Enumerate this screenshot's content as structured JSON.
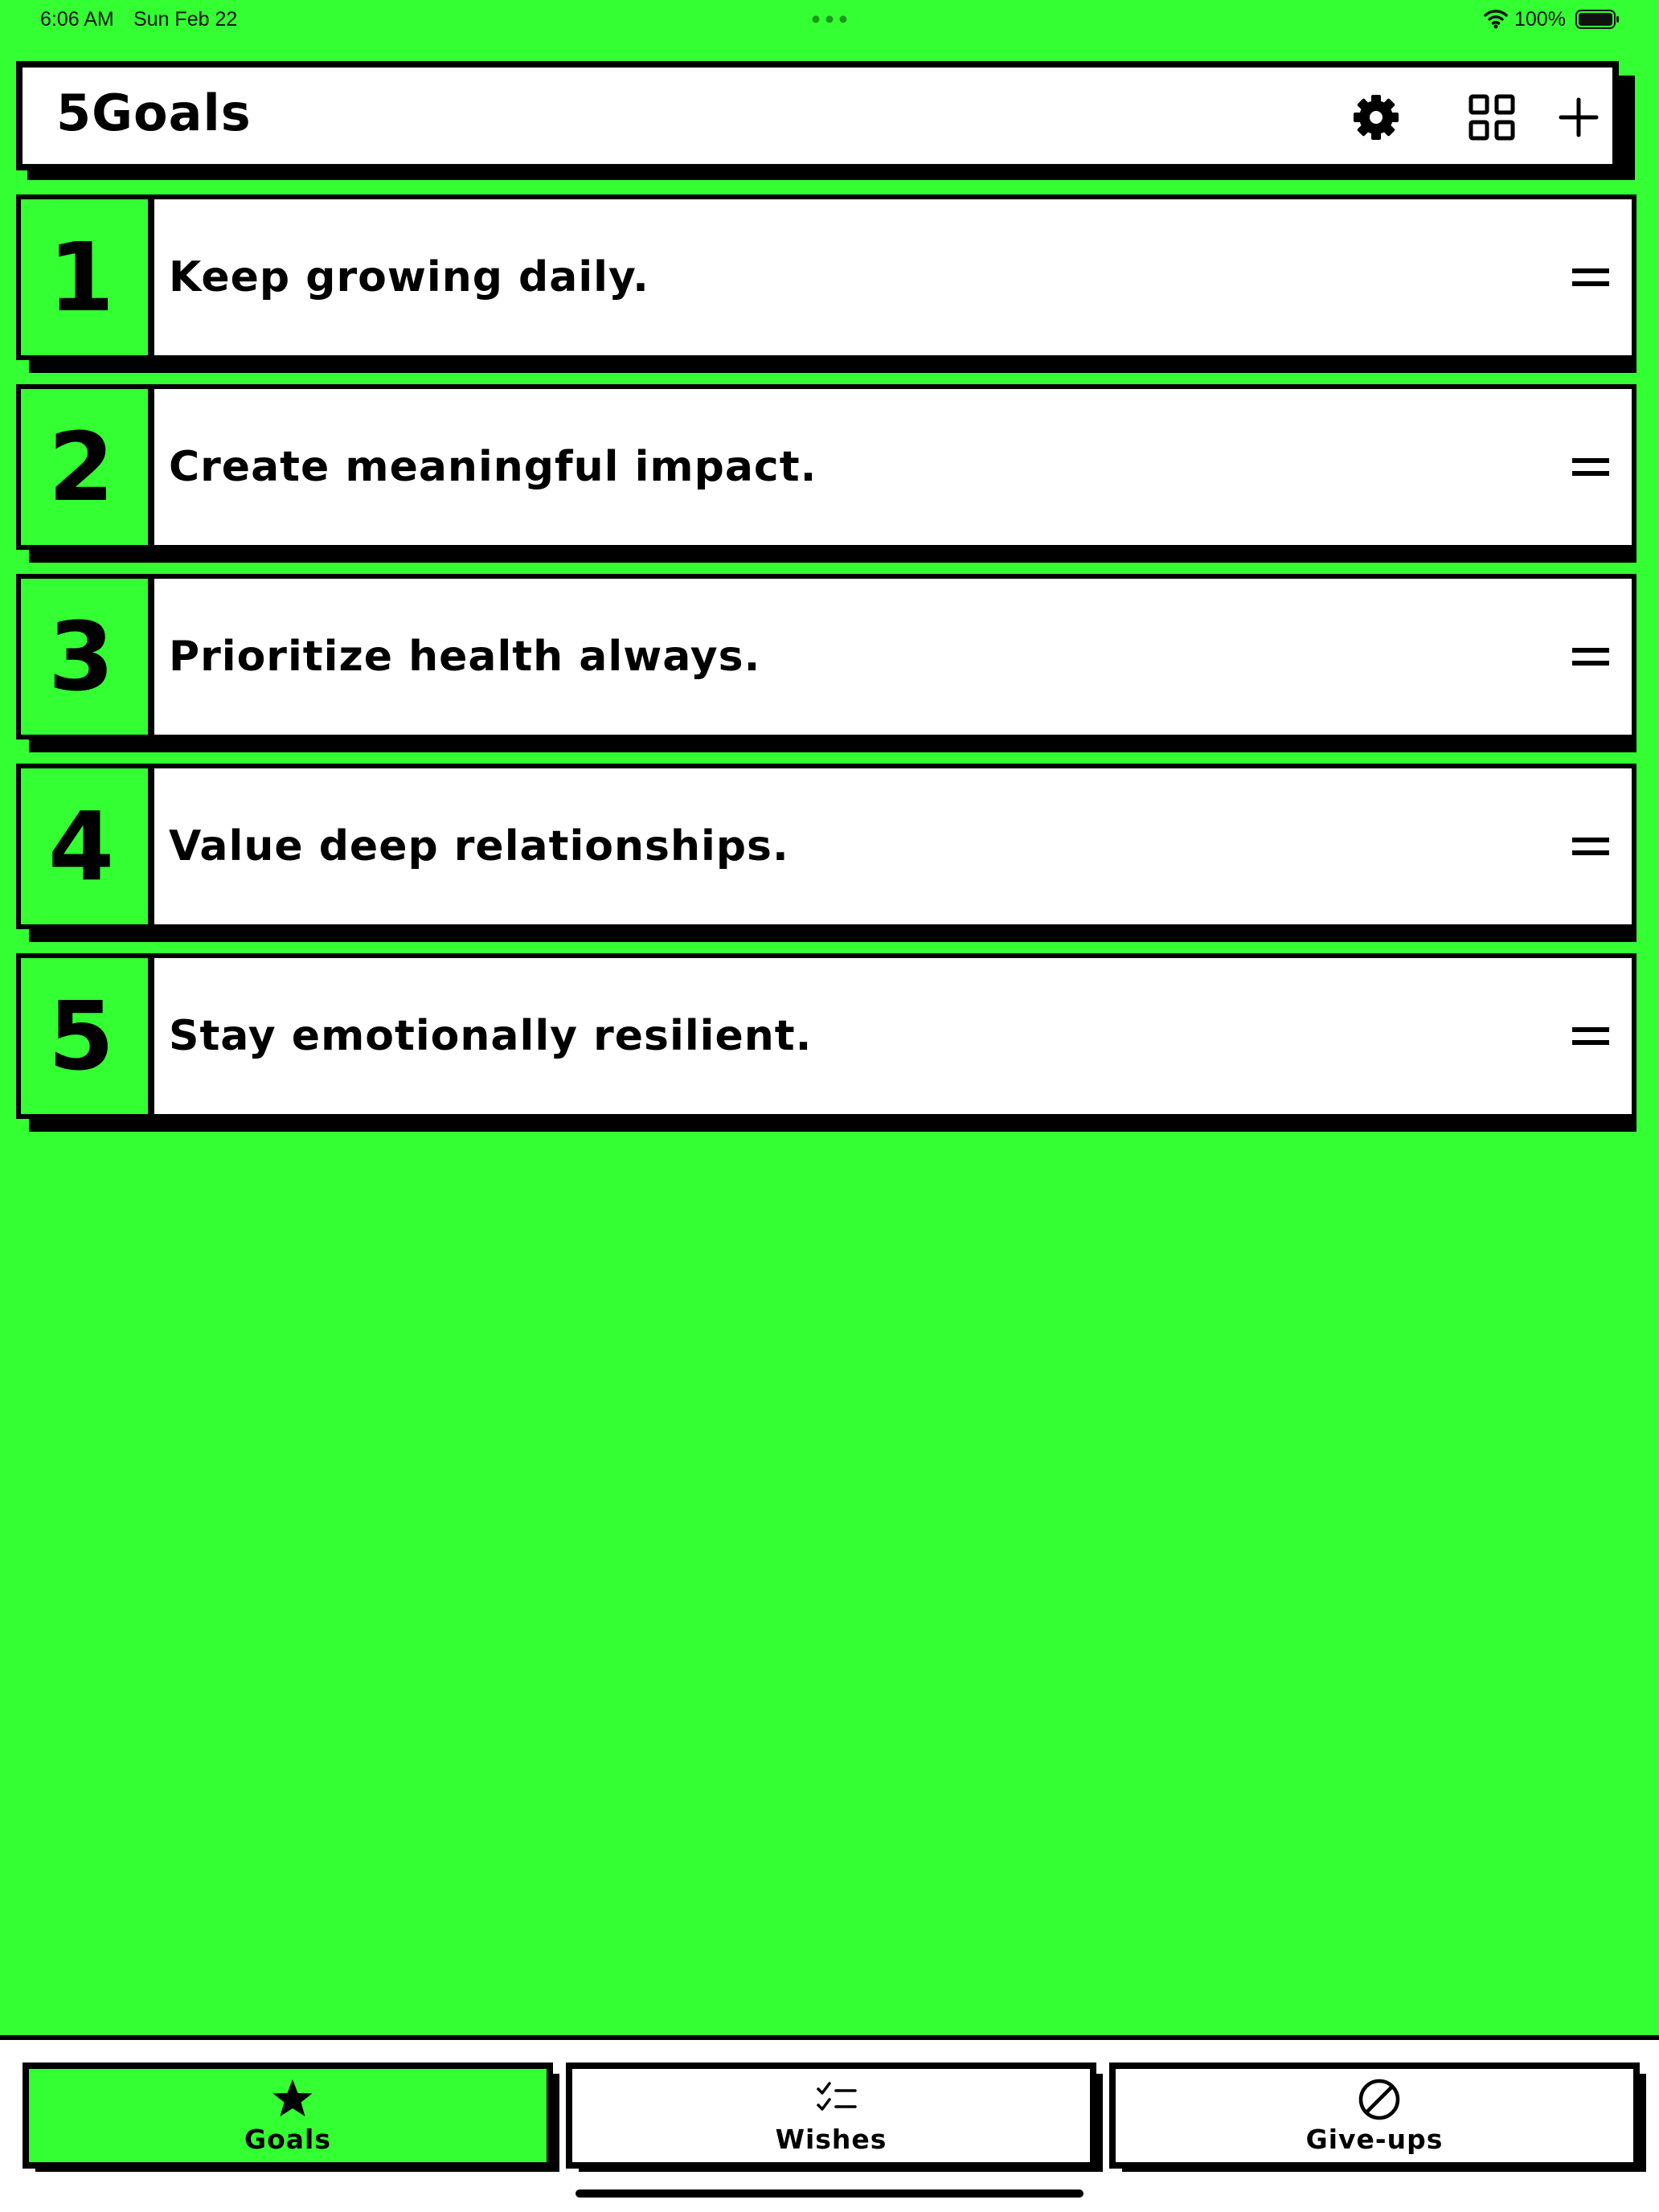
{
  "status_bar": {
    "time": "6:06 AM",
    "date": "Sun Feb 22",
    "battery": "100%"
  },
  "header": {
    "title": "5Goals",
    "icons": [
      "gear-icon",
      "grid-icon",
      "plus-icon"
    ]
  },
  "goals": [
    {
      "number": "1",
      "text": "Keep growing daily."
    },
    {
      "number": "2",
      "text": "Create meaningful impact."
    },
    {
      "number": "3",
      "text": "Prioritize health always."
    },
    {
      "number": "4",
      "text": "Value deep relationships."
    },
    {
      "number": "5",
      "text": "Stay emotionally resilient."
    }
  ],
  "tabs": [
    {
      "label": "Goals",
      "icon": "star-icon",
      "active": true
    },
    {
      "label": "Wishes",
      "icon": "checklist-icon",
      "active": false
    },
    {
      "label": "Give-ups",
      "icon": "prohibited-icon",
      "active": false
    }
  ],
  "colors": {
    "accent": "#33ff33",
    "ink": "#000000",
    "card": "#ffffff"
  }
}
